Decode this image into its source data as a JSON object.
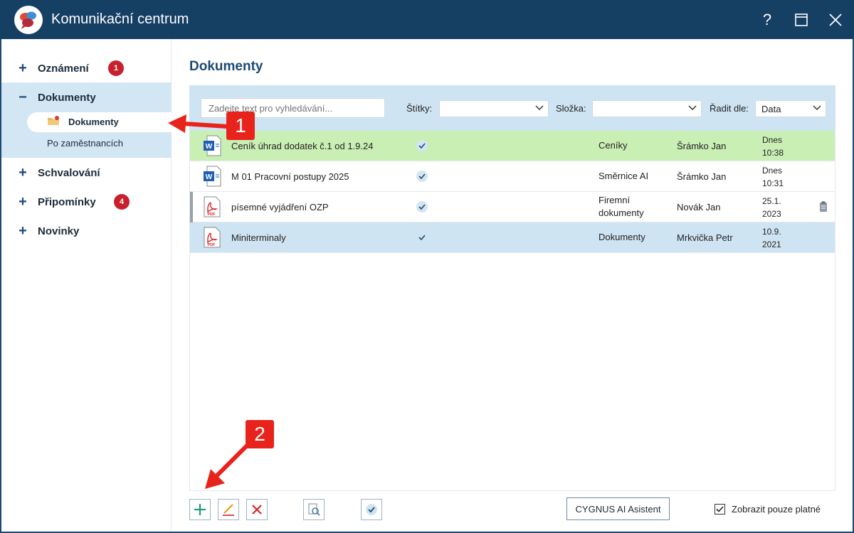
{
  "window": {
    "title": "Komunikační centrum",
    "help_glyph": "?"
  },
  "sidebar": {
    "items": [
      {
        "sign": "+",
        "label": "Oznámení",
        "badge": "1"
      },
      {
        "sign": "−",
        "label": "Dokumenty"
      },
      {
        "sign": "+",
        "label": "Schvalování"
      },
      {
        "sign": "+",
        "label": "Připomínky",
        "badge": "4"
      },
      {
        "sign": "+",
        "label": "Novinky"
      }
    ],
    "subitems": [
      {
        "label": "Dokumenty",
        "active": true
      },
      {
        "label": "Po zaměstnancích"
      }
    ]
  },
  "main": {
    "title": "Dokumenty",
    "search": {
      "placeholder": "Zadejte text pro vyhledávání..."
    },
    "filters": {
      "tags_label": "Štítky:",
      "tags_value": "",
      "folder_label": "Složka:",
      "folder_value": "",
      "sort_label": "Řadit dle:",
      "sort_value": "Data"
    },
    "rows": [
      {
        "type": "word",
        "name": "Ceník úhrad dodatek č.1 od 1.9.24",
        "category": "Ceníky",
        "user": "Šrámko Jan",
        "date_line1": "Dnes",
        "date_line2": "10:38"
      },
      {
        "type": "word",
        "name": "M 01 Pracovní postupy 2025",
        "category": "Směrnice AI",
        "user": "Šrámko Jan",
        "date_line1": "Dnes",
        "date_line2": "10:31"
      },
      {
        "type": "pdf",
        "name": "písemné vyjádření OZP",
        "category_line1": "Firemní",
        "category_line2": "dokumenty",
        "user": "Novák Jan",
        "date_line1": "25.1.",
        "date_line2": "2023"
      },
      {
        "type": "pdf",
        "name": "Miniterminaly",
        "category": "Dokumenty",
        "user": "Mrkvička Petr",
        "date_line1": "10.9.",
        "date_line2": "2021"
      }
    ],
    "file_icon_labels": {
      "word": "W",
      "pdf": "PDF"
    }
  },
  "bottombar": {
    "ai_button": "CYGNUS AI Asistent",
    "only_valid_label": "Zobrazit pouze platné",
    "only_valid_checked": true
  },
  "annotations": {
    "callout1": "1",
    "callout2": "2"
  },
  "colors": {
    "titlebar": "#163f64",
    "accent": "#1c4a73",
    "row_green": "#c9efb4",
    "row_blue": "#cfe4f2",
    "badge": "#c8202d",
    "callout": "#e8231c"
  }
}
